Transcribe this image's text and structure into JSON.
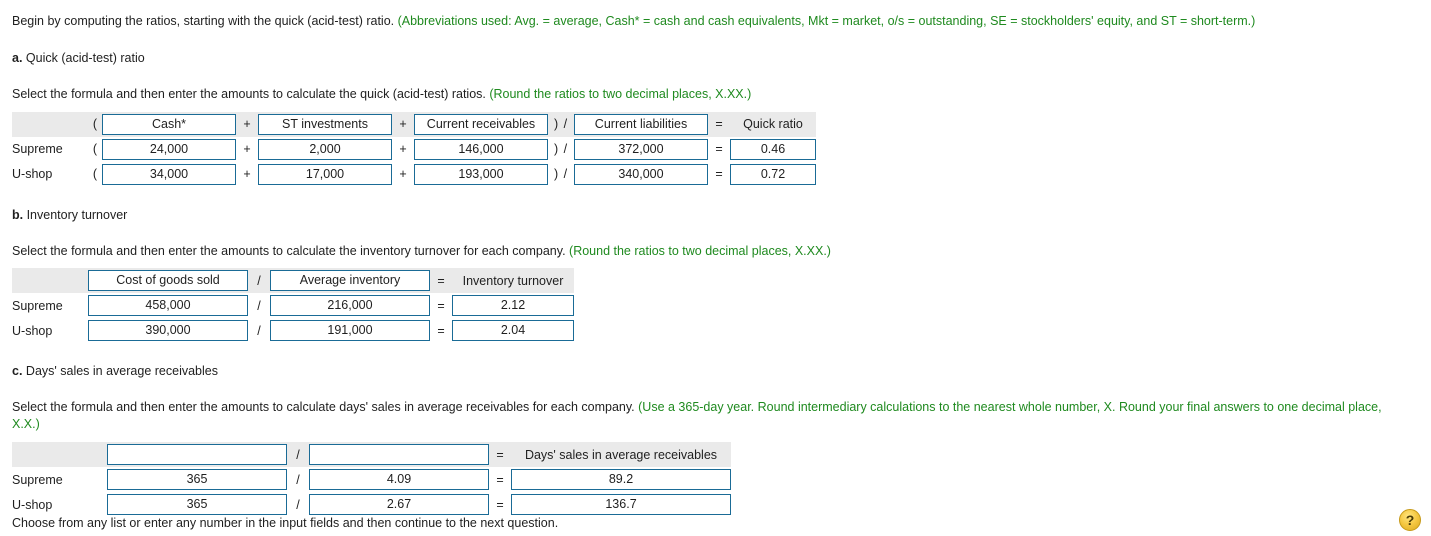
{
  "intro": {
    "text": "Begin by computing the ratios, starting with the quick (acid-test) ratio. ",
    "note": "(Abbreviations used: Avg. = average, Cash* = cash and cash equivalents, Mkt = market, o/s = outstanding, SE = stockholders' equity, and ST = short-term.)"
  },
  "sections": [
    {
      "letter": "a.",
      "title": " Quick (acid-test) ratio",
      "instruction": "Select the formula and then enter the amounts to calculate the quick (acid-test) ratios. ",
      "instruction_note": "(Round the ratios to two decimal places, X.XX.)",
      "header": {
        "label": "",
        "paren_open": "(",
        "f1": "Cash*",
        "op1": "+",
        "f2": "ST investments",
        "op2": "+",
        "f3": "Current receivables",
        "paren_div": ") /",
        "f4": "Current liabilities",
        "eq": "=",
        "result": "Quick ratio"
      },
      "rows": [
        {
          "label": "Supreme",
          "paren_open": "(",
          "v1": "24,000",
          "op1": "+",
          "v2": "2,000",
          "op2": "+",
          "v3": "146,000",
          "paren_div": ") /",
          "v4": "372,000",
          "eq": "=",
          "result": "0.46"
        },
        {
          "label": "U-shop",
          "paren_open": "(",
          "v1": "34,000",
          "op1": "+",
          "v2": "17,000",
          "op2": "+",
          "v3": "193,000",
          "paren_div": ") /",
          "v4": "340,000",
          "eq": "=",
          "result": "0.72"
        }
      ]
    },
    {
      "letter": "b.",
      "title": " Inventory turnover",
      "instruction": "Select the formula and then enter the amounts to calculate the inventory turnover for each company. ",
      "instruction_note": "(Round the ratios to two decimal places, X.XX.)",
      "header": {
        "label": "",
        "f1": "Cost of goods sold",
        "op1": "/",
        "f2": "Average inventory",
        "eq": "=",
        "result": "Inventory turnover"
      },
      "rows": [
        {
          "label": "Supreme",
          "v1": "458,000",
          "op1": "/",
          "v2": "216,000",
          "eq": "=",
          "result": "2.12"
        },
        {
          "label": "U-shop",
          "v1": "390,000",
          "op1": "/",
          "v2": "191,000",
          "eq": "=",
          "result": "2.04"
        }
      ]
    },
    {
      "letter": "c.",
      "title": " Days' sales in average receivables",
      "instruction": "Select the formula and then enter the amounts to calculate days' sales in average receivables for each company. ",
      "instruction_note": "(Use a 365-day year. Round intermediary calculations to the nearest whole number, X. Round your final answers to one decimal place, X.X.)",
      "header": {
        "label": "",
        "f1": "",
        "op1": "/",
        "f2": "",
        "eq": "=",
        "result": "Days' sales in average receivables"
      },
      "rows": [
        {
          "label": "Supreme",
          "v1": "365",
          "op1": "/",
          "v2": "4.09",
          "eq": "=",
          "result": "89.2"
        },
        {
          "label": "U-shop",
          "v1": "365",
          "op1": "/",
          "v2": "2.67",
          "eq": "=",
          "result": "136.7"
        }
      ]
    }
  ],
  "footer": {
    "text": "Choose from any list or enter any number in the input fields and then continue to the next question.",
    "help_glyph": "?"
  },
  "colors": {
    "field_border": "#1a6b96",
    "header_bg": "#eaeaea",
    "note_green": "#1f8a1f",
    "help_yellow": "#f5c842"
  }
}
